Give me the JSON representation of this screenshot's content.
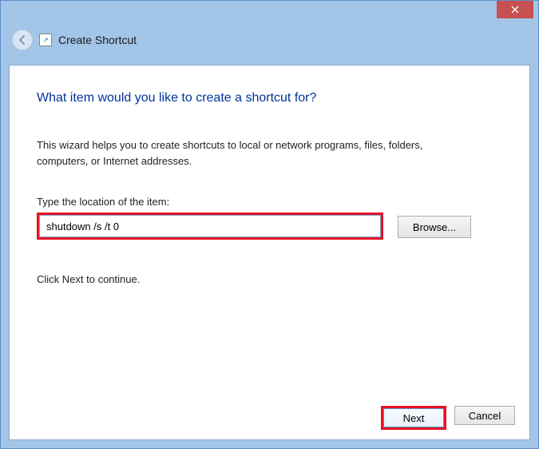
{
  "window": {
    "title": "Create Shortcut"
  },
  "headline": "What item would you like to create a shortcut for?",
  "description": "This wizard helps you to create shortcuts to local or network programs, files, folders, computers, or Internet addresses.",
  "input_label": "Type the location of the item:",
  "input_value": "shutdown /s /t 0",
  "browse_label": "Browse...",
  "continue_text": "Click Next to continue.",
  "buttons": {
    "next": "Next",
    "cancel": "Cancel"
  }
}
